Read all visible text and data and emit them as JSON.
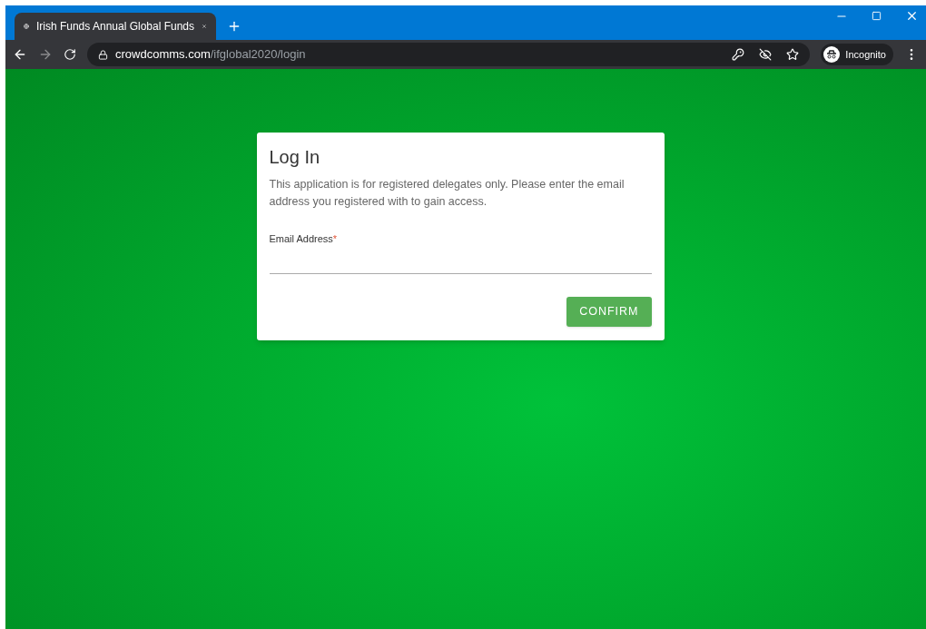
{
  "browser": {
    "tab": {
      "title": "Irish Funds Annual Global Funds"
    },
    "url": {
      "domain": "crowdcomms.com",
      "path": "/ifglobal2020/login"
    },
    "profile": {
      "label": "Incognito"
    }
  },
  "login": {
    "title": "Log In",
    "description": "This application is for registered delegates only. Please enter the email address you registered with to gain access.",
    "email_field": {
      "label": "Email Address",
      "required_mark": "*"
    },
    "confirm_button": "CONFIRM"
  }
}
